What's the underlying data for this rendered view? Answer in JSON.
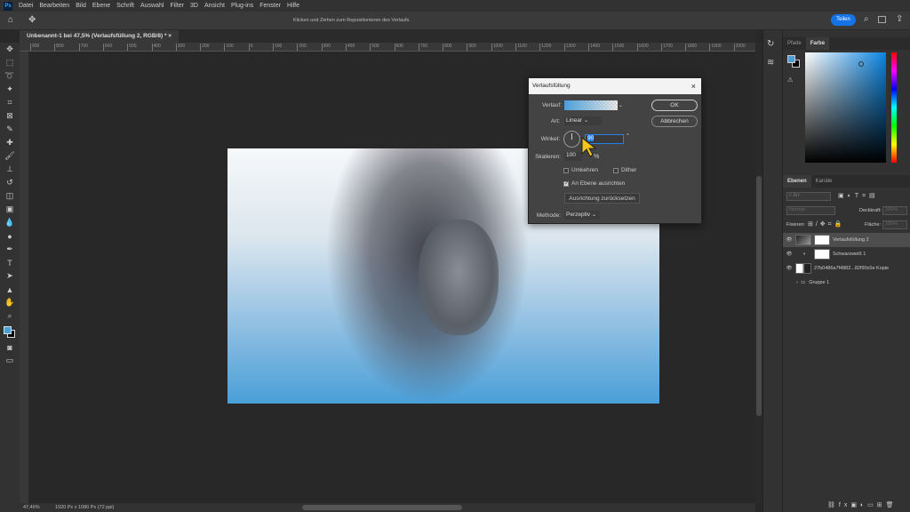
{
  "menubar": {
    "logo": "Ps",
    "items": [
      "Datei",
      "Bearbeiten",
      "Bild",
      "Ebene",
      "Schrift",
      "Auswahl",
      "Filter",
      "3D",
      "Ansicht",
      "Plug-ins",
      "Fenster",
      "Hilfe"
    ]
  },
  "options": {
    "hint": "Klicken und Ziehen zum Repositionieren des Verlaufs.",
    "share_label": "Teilen"
  },
  "document": {
    "tab_title": "Unbenannt-1 bei 47,5% (Verlaufsfüllung 2, RGB/8) *",
    "ruler_labels": [
      "900",
      "800",
      "700",
      "600",
      "500",
      "400",
      "300",
      "200",
      "100",
      "0",
      "100",
      "200",
      "300",
      "400",
      "500",
      "600",
      "700",
      "800",
      "900",
      "1000",
      "1100",
      "1200",
      "1300",
      "1400",
      "1500",
      "1600",
      "1700",
      "1800",
      "1900",
      "2000",
      "2100"
    ]
  },
  "status": {
    "zoom": "47,46%",
    "size": "1920 Px x 1080 Px (72 ppi)"
  },
  "color_panel": {
    "tabs": [
      "Pfade",
      "Farbe"
    ],
    "foreground": "#4a9fd8",
    "background": "#000000"
  },
  "layers_panel": {
    "tabs": [
      "Ebenen",
      "Kanäle"
    ],
    "filter_placeholder": "Art",
    "blend_mode": "Normal",
    "opacity_label": "Deckkraft:",
    "opacity": "100%",
    "lock_label": "Fixieren:",
    "fill_label": "Fläche:",
    "fill": "100%",
    "layers": [
      {
        "name": "Verlaufsfüllung 2",
        "selected": true
      },
      {
        "name": "Schwarzweiß 1"
      },
      {
        "name": "27b0486a7f4882...82f90c0e Kopie"
      },
      {
        "name": "Gruppe 1"
      }
    ]
  },
  "dialog": {
    "title": "Verlaufsfüllung",
    "gradient_label": "Verlauf:",
    "style_label": "Art:",
    "style_value": "Linear",
    "angle_label": "Winkel:",
    "angle_value": "90",
    "degree": "°",
    "scale_label": "Skalieren:",
    "scale_value": "100",
    "percent": "%",
    "reverse_label": "Umkehren",
    "dither_label": "Dither",
    "align_label": "An Ebene ausrichten",
    "reset_label": "Ausrichtung zurücksetzen",
    "method_label": "Methode:",
    "method_value": "Perzeptiv",
    "ok_label": "OK",
    "cancel_label": "Abbrechen",
    "align_checked": true,
    "reverse_checked": false,
    "dither_checked": false
  }
}
